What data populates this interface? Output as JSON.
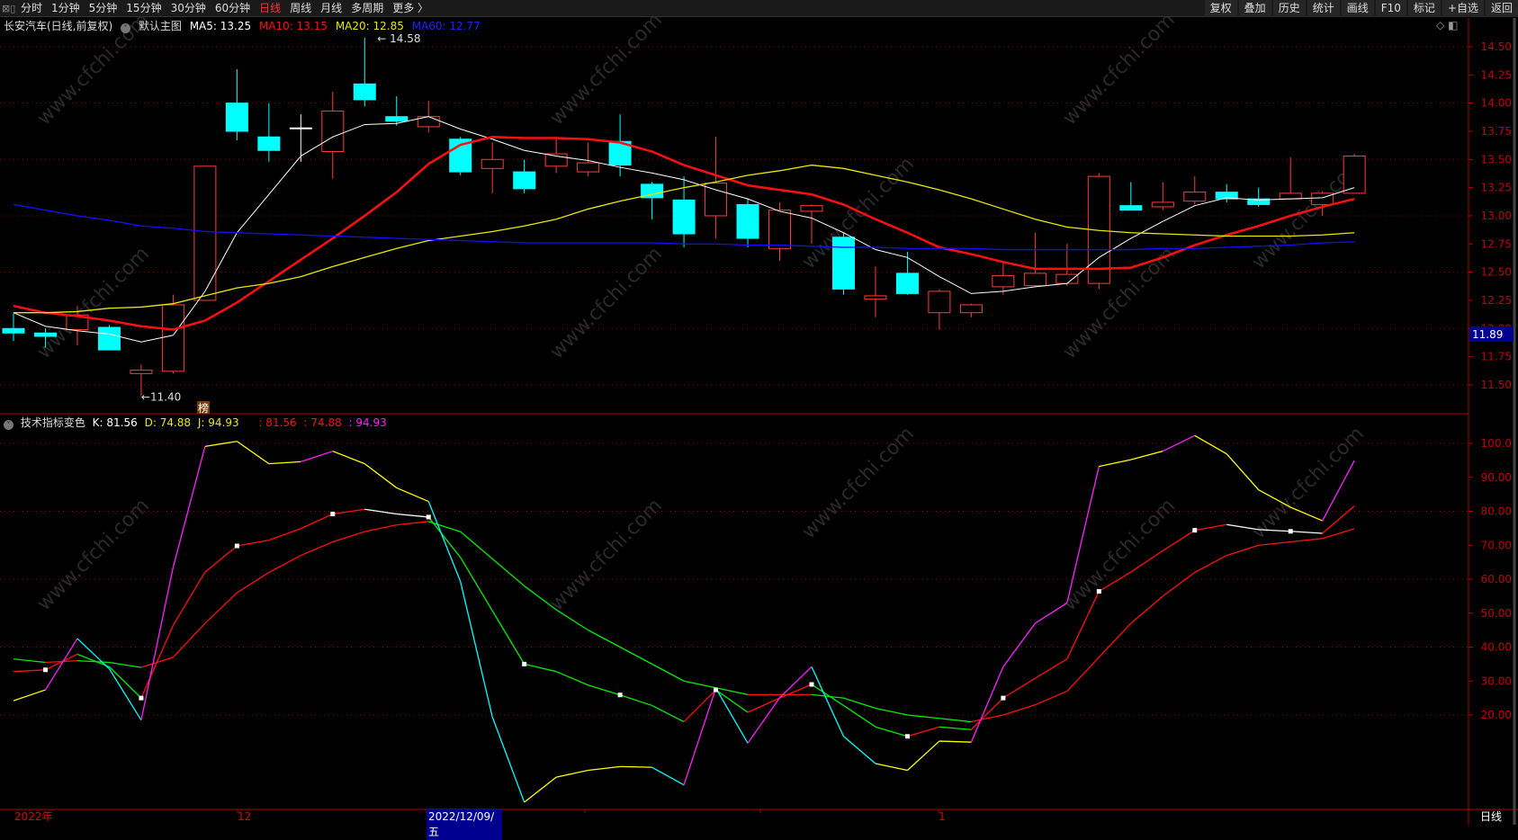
{
  "topbar": {
    "tabs": [
      "分时",
      "1分钟",
      "5分钟",
      "15分钟",
      "30分钟",
      "60分钟",
      "日线",
      "周线",
      "月线",
      "多周期",
      "更多 〉"
    ],
    "active": "日线",
    "buttons": [
      "复权",
      "叠加",
      "历史",
      "统计",
      "画线",
      "F10",
      "标记",
      "+自选",
      "返回"
    ]
  },
  "header": {
    "stock": "长安汽车(日线,前复权)",
    "template": "默认主图",
    "ma5": "MA5: 13.25",
    "ma10": "MA10: 13.15",
    "ma20": "MA20: 12.85",
    "ma60": "MA60: 12.77"
  },
  "kdj_header": {
    "name": "技术指标变色",
    "k": "K: 81.56",
    "d": "D: 74.88",
    "j": "J: 94.93",
    "v1": ": 81.56",
    "v2": ": 74.88",
    "v3": ": 94.93"
  },
  "annotations": {
    "high": "14.58",
    "low": "11.40",
    "badge": "榜",
    "current_price": "11.89"
  },
  "watermark": "www.cfchi.com",
  "xaxis": {
    "year": "2022年",
    "dec": "12",
    "selected": "2022/12/09/五",
    "jan": "1",
    "period": "日线"
  },
  "colors": {
    "up": "#ff3b3b",
    "down": "#00ffff",
    "ma5": "#ffffff",
    "ma10": "#ff1010",
    "ma20": "#e8e800",
    "ma60": "#1010ff",
    "grid": "#8b0000",
    "axis": "#b00000"
  },
  "chart_data": [
    {
      "type": "candlestick",
      "title": "长安汽车 日线",
      "ylim": [
        11.35,
        14.6
      ],
      "yticks": [
        "14.50",
        "14.25",
        "14.00",
        "13.75",
        "13.50",
        "13.25",
        "13.00",
        "12.75",
        "12.50",
        "12.25",
        "12.00",
        "11.75",
        "11.50"
      ],
      "ohlc": [
        [
          12.0,
          12.14,
          11.89,
          11.96
        ],
        [
          11.96,
          12.0,
          11.83,
          11.93
        ],
        [
          11.99,
          12.2,
          11.85,
          12.12
        ],
        [
          12.01,
          12.03,
          11.81,
          11.81
        ],
        [
          11.6,
          11.68,
          11.4,
          11.63
        ],
        [
          11.62,
          12.3,
          11.6,
          12.21
        ],
        [
          12.25,
          13.44,
          12.25,
          13.44
        ],
        [
          14.0,
          14.3,
          13.67,
          13.75
        ],
        [
          13.7,
          14.0,
          13.48,
          13.58
        ],
        [
          13.78,
          13.9,
          13.48,
          13.78
        ],
        [
          13.57,
          14.1,
          13.33,
          13.93
        ],
        [
          14.17,
          14.58,
          13.97,
          14.03
        ],
        [
          13.88,
          14.06,
          13.8,
          13.84
        ],
        [
          13.79,
          14.02,
          13.74,
          13.88
        ],
        [
          13.68,
          13.7,
          13.36,
          13.39
        ],
        [
          13.42,
          13.65,
          13.2,
          13.5
        ],
        [
          13.39,
          13.5,
          13.2,
          13.24
        ],
        [
          13.44,
          13.7,
          13.38,
          13.55
        ],
        [
          13.39,
          13.65,
          13.35,
          13.47
        ],
        [
          13.66,
          13.9,
          13.35,
          13.45
        ],
        [
          13.28,
          13.3,
          12.97,
          13.16
        ],
        [
          13.14,
          13.35,
          12.72,
          12.84
        ],
        [
          13.0,
          13.7,
          12.8,
          13.29
        ],
        [
          13.1,
          13.15,
          12.72,
          12.8
        ],
        [
          12.71,
          13.12,
          12.6,
          13.05
        ],
        [
          13.04,
          13.1,
          12.75,
          13.09
        ],
        [
          12.81,
          12.85,
          12.3,
          12.35
        ],
        [
          12.26,
          12.55,
          12.1,
          12.29
        ],
        [
          12.49,
          12.68,
          12.3,
          12.31
        ],
        [
          12.14,
          12.35,
          11.99,
          12.33
        ],
        [
          12.14,
          12.22,
          12.1,
          12.21
        ],
        [
          12.37,
          12.6,
          12.3,
          12.47
        ],
        [
          12.38,
          12.85,
          12.38,
          12.49
        ],
        [
          12.4,
          12.75,
          12.38,
          12.48
        ],
        [
          12.4,
          13.38,
          12.35,
          13.35
        ],
        [
          13.09,
          13.3,
          13.05,
          13.05
        ],
        [
          13.08,
          13.3,
          13.05,
          13.12
        ],
        [
          13.13,
          13.35,
          13.1,
          13.21
        ],
        [
          13.21,
          13.28,
          13.12,
          13.15
        ],
        [
          13.15,
          13.25,
          13.08,
          13.1
        ],
        [
          13.15,
          13.52,
          13.15,
          13.2
        ],
        [
          13.1,
          13.22,
          13.0,
          13.2
        ],
        [
          13.2,
          13.55,
          13.2,
          13.53
        ]
      ],
      "series": [
        {
          "name": "MA5",
          "values": [
            12.14,
            12.02,
            11.98,
            11.95,
            11.88,
            11.94,
            12.33,
            12.85,
            13.19,
            13.53,
            13.7,
            13.81,
            13.82,
            13.88,
            13.77,
            13.68,
            13.58,
            13.53,
            13.49,
            13.43,
            13.38,
            13.32,
            13.23,
            13.15,
            13.04,
            12.98,
            12.85,
            12.7,
            12.63,
            12.46,
            12.31,
            12.33,
            12.37,
            12.4,
            12.63,
            12.8,
            12.95,
            13.09,
            13.16,
            13.14,
            13.15,
            13.16,
            13.25
          ]
        },
        {
          "name": "MA10",
          "values": [
            12.2,
            12.14,
            12.11,
            12.07,
            12.02,
            11.99,
            12.07,
            12.23,
            12.42,
            12.61,
            12.8,
            13.0,
            13.21,
            13.46,
            13.63,
            13.7,
            13.69,
            13.69,
            13.68,
            13.65,
            13.57,
            13.45,
            13.36,
            13.27,
            13.23,
            13.19,
            13.1,
            12.97,
            12.85,
            12.72,
            12.66,
            12.59,
            12.53,
            12.53,
            12.53,
            12.54,
            12.63,
            12.74,
            12.83,
            12.91,
            13.0,
            13.08,
            13.15
          ]
        },
        {
          "name": "MA20",
          "values": [
            12.14,
            12.14,
            12.15,
            12.18,
            12.19,
            12.22,
            12.29,
            12.36,
            12.4,
            12.46,
            12.55,
            12.63,
            12.71,
            12.78,
            12.82,
            12.86,
            12.91,
            12.97,
            13.06,
            13.13,
            13.19,
            13.25,
            13.3,
            13.36,
            13.4,
            13.45,
            13.42,
            13.36,
            13.3,
            13.23,
            13.15,
            13.06,
            12.97,
            12.9,
            12.87,
            12.85,
            12.84,
            12.83,
            12.82,
            12.82,
            12.82,
            12.83,
            12.85
          ]
        },
        {
          "name": "MA60",
          "values": [
            13.1,
            13.05,
            13.0,
            12.96,
            12.91,
            12.89,
            12.86,
            12.85,
            12.84,
            12.83,
            12.82,
            12.81,
            12.8,
            12.79,
            12.78,
            12.77,
            12.76,
            12.76,
            12.76,
            12.76,
            12.76,
            12.75,
            12.75,
            12.74,
            12.74,
            12.73,
            12.72,
            12.72,
            12.71,
            12.71,
            12.71,
            12.7,
            12.7,
            12.7,
            12.7,
            12.7,
            12.71,
            12.71,
            12.72,
            12.73,
            12.74,
            12.76,
            12.77
          ]
        }
      ]
    },
    {
      "type": "line",
      "title": "技术指标变色 KDJ",
      "ylim": [
        -8,
        105
      ],
      "yticks": [
        "100.0",
        "90.00",
        "80.00",
        "70.00",
        "60.00",
        "50.00",
        "40.00",
        "30.00",
        "20.00"
      ],
      "series": [
        {
          "name": "K",
          "values": [
            32.8,
            33.3,
            37.9,
            34.2,
            25,
            46.4,
            62.1,
            69.8,
            71.5,
            74.9,
            79.2,
            80.6,
            79.2,
            78.3,
            66.4,
            50.7,
            35,
            32.8,
            28.8,
            25.9,
            22.8,
            18,
            27.4,
            20.8,
            25,
            29,
            22.8,
            16.5,
            13.7,
            16.5,
            15.7,
            25,
            30.8,
            36.5,
            56.4,
            62.1,
            68.4,
            74.4,
            76.1,
            74.6,
            74.1,
            73.5,
            81.56
          ]
        },
        {
          "name": "D",
          "values": [
            36.5,
            35.5,
            36,
            35.5,
            34,
            37,
            47,
            56,
            62,
            67,
            71,
            74,
            76,
            77,
            74,
            66,
            58,
            51,
            45,
            40,
            35,
            30,
            28,
            26,
            26,
            26,
            25,
            22,
            20,
            19,
            18,
            20,
            23,
            27,
            37,
            47,
            55,
            62,
            67,
            70,
            71,
            72,
            74.88
          ]
        },
        {
          "name": "J",
          "values": [
            24.2,
            27.4,
            42.5,
            33.6,
            18.5,
            63.5,
            99.1,
            100.6,
            94,
            94.6,
            97.7,
            94,
            86.9,
            82.9,
            59.3,
            19.4,
            -5.7,
            1.7,
            3.7,
            4.8,
            4.6,
            -0.6,
            27.9,
            11.7,
            25.1,
            34.2,
            13.7,
            5.7,
            3.7,
            12.3,
            12,
            34.2,
            47,
            53,
            93.2,
            95.2,
            97.7,
            102.3,
            96.9,
            86.3,
            81.2,
            77.2,
            94.93
          ]
        }
      ]
    }
  ]
}
